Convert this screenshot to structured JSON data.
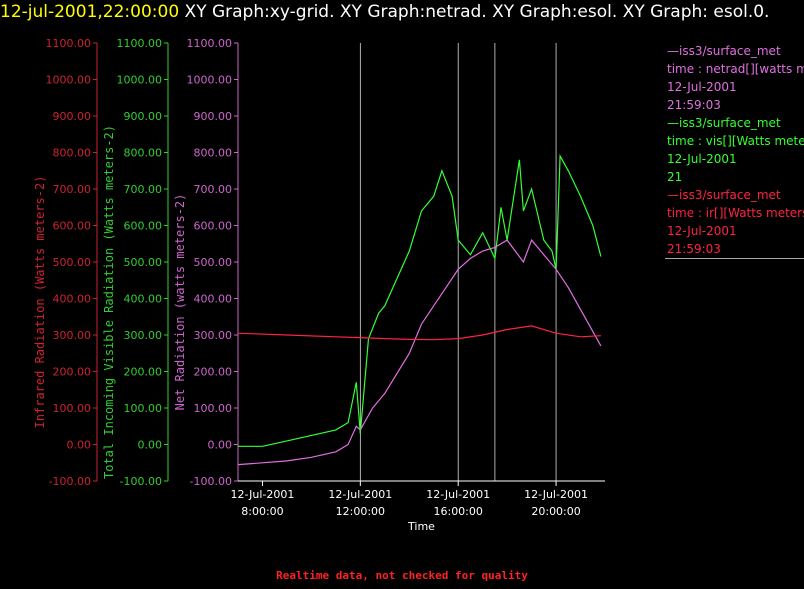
{
  "title": {
    "timestamp": "12-jul-2001,22:00:00",
    "text": " XY Graph:xy-grid.  XY Graph:netrad.  XY Graph:esol.  XY Graph: esol.0."
  },
  "colors": {
    "netrad": "#e070e0",
    "vis": "#33ff33",
    "ir": "#ff2244",
    "grid": "#ffffff",
    "axis_netrad": "#cc66cc",
    "axis_vis": "#33cc33",
    "axis_ir": "#cc2233",
    "xaxis": "#ffffff"
  },
  "legend": [
    {
      "header": "—iss3/surface_met",
      "var": "time : netrad[][watts meters-2]",
      "date": "12-Jul-2001",
      "time": "21:59:03",
      "color": "#e070e0"
    },
    {
      "header": "—iss3/surface_met",
      "var": "time : vis[][Watts meters-2]",
      "date": "12-Jul-2001",
      "time": "21",
      "color": "#33ff33"
    },
    {
      "header": "—iss3/surface_met",
      "var": "time : ir[][Watts meters-2]",
      "date": "12-Jul-2001",
      "time": "21:59:03",
      "color": "#ff2244"
    }
  ],
  "footer": "Realtime data, not checked for quality",
  "chart_data": {
    "type": "line",
    "xlabel": "Time",
    "x_range": [
      "2001-07-12 07:00",
      "2001-07-12 22:00"
    ],
    "x_ticks": [
      {
        "t": "2001-07-12 08:00",
        "label1": "12-Jul-2001",
        "label2": "8:00:00"
      },
      {
        "t": "2001-07-12 12:00",
        "label1": "12-Jul-2001",
        "label2": "12:00:00"
      },
      {
        "t": "2001-07-12 16:00",
        "label1": "12-Jul-2001",
        "label2": "16:00:00"
      },
      {
        "t": "2001-07-12 20:00",
        "label1": "12-Jul-2001",
        "label2": "20:00:00"
      }
    ],
    "grid_vertical": [
      "2001-07-12 12:00",
      "2001-07-12 16:00",
      "2001-07-12 17:30",
      "2001-07-12 20:00"
    ],
    "y_axes": [
      {
        "key": "ir",
        "label": "Infrared Radiation (Watts meters-2)",
        "ylim": [
          -100,
          1100
        ],
        "color": "#cc2233"
      },
      {
        "key": "vis",
        "label": "Total Incoming Visible Radiation (Watts meters-2)",
        "ylim": [
          -100,
          1100
        ],
        "color": "#33cc33"
      },
      {
        "key": "netrad",
        "label": "Net Radiation (watts meters-2)",
        "ylim": [
          -100,
          1100
        ],
        "color": "#cc66cc"
      }
    ],
    "y_ticks": [
      -100,
      0,
      100,
      200,
      300,
      400,
      500,
      600,
      700,
      800,
      900,
      1000,
      1100
    ],
    "y_tick_labels": [
      "-100.00",
      "0.00",
      "100.00",
      "200.00",
      "300.00",
      "400.00",
      "500.00",
      "600.00",
      "700.00",
      "800.00",
      "900.00",
      "1000.00",
      "1100.00"
    ],
    "series": [
      {
        "key": "vis",
        "color": "#33ff33",
        "t": [
          "2001-07-12 07:00",
          "2001-07-12 08:00",
          "2001-07-12 09:00",
          "2001-07-12 10:00",
          "2001-07-12 11:00",
          "2001-07-12 11:30",
          "2001-07-12 11:50",
          "2001-07-12 12:00",
          "2001-07-12 12:20",
          "2001-07-12 12:45",
          "2001-07-12 13:00",
          "2001-07-12 14:00",
          "2001-07-12 14:30",
          "2001-07-12 15:00",
          "2001-07-12 15:20",
          "2001-07-12 15:45",
          "2001-07-12 16:00",
          "2001-07-12 16:30",
          "2001-07-12 17:00",
          "2001-07-12 17:30",
          "2001-07-12 17:45",
          "2001-07-12 18:00",
          "2001-07-12 18:30",
          "2001-07-12 18:40",
          "2001-07-12 19:00",
          "2001-07-12 19:30",
          "2001-07-12 19:50",
          "2001-07-12 20:00",
          "2001-07-12 20:10",
          "2001-07-12 20:30",
          "2001-07-12 21:00",
          "2001-07-12 21:30",
          "2001-07-12 21:50"
        ],
        "values": [
          -5,
          -5,
          10,
          25,
          40,
          60,
          170,
          30,
          290,
          360,
          380,
          530,
          640,
          680,
          750,
          680,
          560,
          520,
          580,
          510,
          650,
          560,
          780,
          640,
          700,
          560,
          530,
          480,
          790,
          750,
          680,
          600,
          515
        ]
      },
      {
        "key": "netrad",
        "color": "#e070e0",
        "t": [
          "2001-07-12 07:00",
          "2001-07-12 08:00",
          "2001-07-12 09:00",
          "2001-07-12 10:00",
          "2001-07-12 11:00",
          "2001-07-12 11:30",
          "2001-07-12 11:50",
          "2001-07-12 12:00",
          "2001-07-12 12:30",
          "2001-07-12 13:00",
          "2001-07-12 14:00",
          "2001-07-12 14:30",
          "2001-07-12 15:00",
          "2001-07-12 15:30",
          "2001-07-12 16:00",
          "2001-07-12 16:30",
          "2001-07-12 17:00",
          "2001-07-12 17:30",
          "2001-07-12 18:00",
          "2001-07-12 18:40",
          "2001-07-12 19:00",
          "2001-07-12 19:30",
          "2001-07-12 20:00",
          "2001-07-12 20:30",
          "2001-07-12 21:00",
          "2001-07-12 21:30",
          "2001-07-12 21:50"
        ],
        "values": [
          -55,
          -50,
          -45,
          -35,
          -20,
          0,
          50,
          40,
          100,
          140,
          250,
          330,
          380,
          430,
          480,
          510,
          530,
          540,
          560,
          500,
          560,
          520,
          480,
          430,
          370,
          310,
          270
        ]
      },
      {
        "key": "ir",
        "color": "#ff2244",
        "t": [
          "2001-07-12 07:00",
          "2001-07-12 09:00",
          "2001-07-12 11:00",
          "2001-07-12 12:00",
          "2001-07-12 13:00",
          "2001-07-12 14:00",
          "2001-07-12 15:00",
          "2001-07-12 16:00",
          "2001-07-12 17:00",
          "2001-07-12 18:00",
          "2001-07-12 19:00",
          "2001-07-12 20:00",
          "2001-07-12 21:00",
          "2001-07-12 21:50"
        ],
        "values": [
          305,
          300,
          295,
          293,
          290,
          288,
          287,
          290,
          300,
          315,
          325,
          305,
          295,
          298
        ]
      }
    ]
  }
}
